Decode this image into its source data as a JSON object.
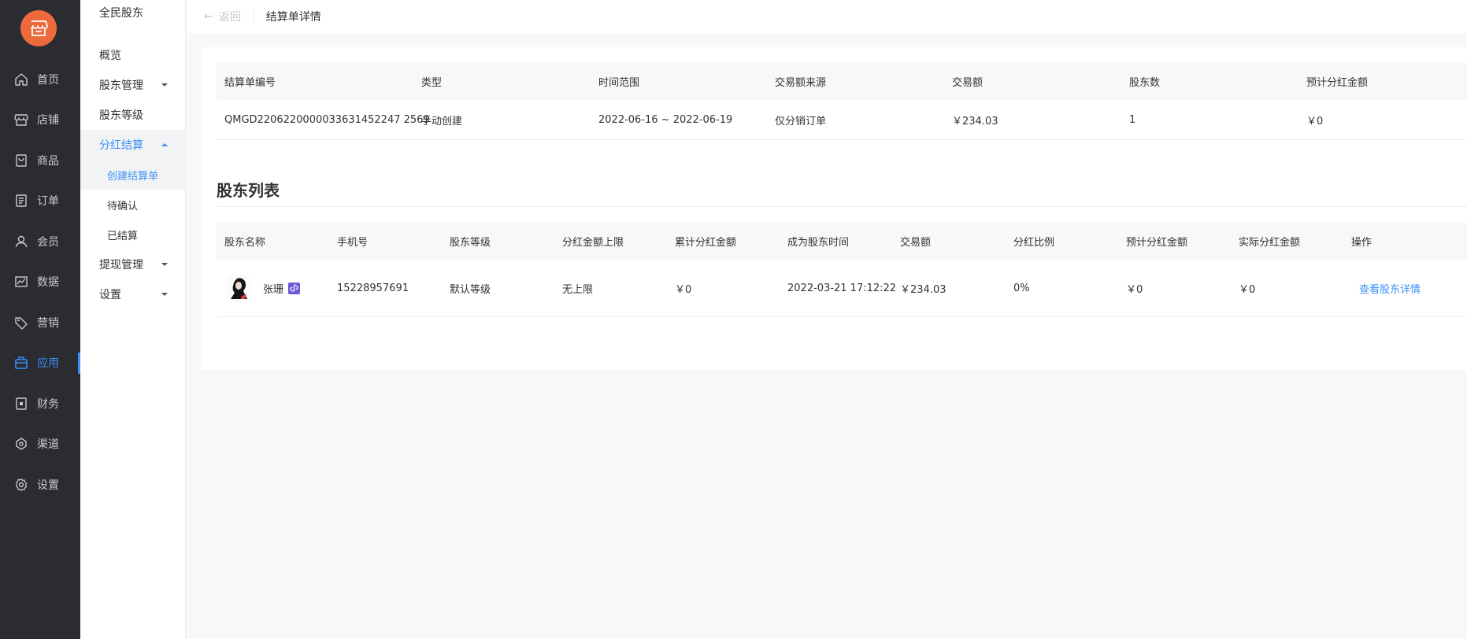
{
  "nav1": {
    "items": [
      {
        "label": "首页",
        "icon": "home-icon"
      },
      {
        "label": "店铺",
        "icon": "store-icon"
      },
      {
        "label": "商品",
        "icon": "goods-icon"
      },
      {
        "label": "订单",
        "icon": "order-icon"
      },
      {
        "label": "会员",
        "icon": "member-icon"
      },
      {
        "label": "数据",
        "icon": "chart-icon"
      },
      {
        "label": "营销",
        "icon": "tag-icon"
      },
      {
        "label": "应用",
        "icon": "apps-icon"
      },
      {
        "label": "财务",
        "icon": "finance-icon"
      },
      {
        "label": "渠道",
        "icon": "channel-icon"
      },
      {
        "label": "设置",
        "icon": "gear-icon"
      }
    ],
    "active_index": 7,
    "accent": "#3b8ff7",
    "logo_color": "#ee6a3c"
  },
  "nav2": {
    "title": "全民股东",
    "overview": "概览",
    "shareholder_mgmt": "股东管理",
    "shareholder_level": "股东等级",
    "dividend": "分红结算",
    "sub_create": "创建结算单",
    "sub_pending": "待确认",
    "sub_settled": "已结算",
    "withdraw": "提现管理",
    "settings": "设置"
  },
  "header": {
    "back": "返回",
    "title": "结算单详情"
  },
  "summary": {
    "headers": [
      "结算单编号",
      "类型",
      "时间范围",
      "交易额来源",
      "交易额",
      "股东数",
      "预计分红金额"
    ],
    "row": [
      "QMGD2206220000033631452247 2569",
      "手动创建",
      "2022-06-16 ~ 2022-06-19",
      "仅分销订单",
      "￥234.03",
      "1",
      "￥0"
    ]
  },
  "list": {
    "title": "股东列表",
    "headers": [
      "股东名称",
      "手机号",
      "股东等级",
      "分红金额上限",
      "累计分红金额",
      "成为股东时间",
      "交易额",
      "分红比例",
      "预计分红金额",
      "实际分红金额",
      "操作"
    ],
    "rows": [
      {
        "name": "张珊",
        "phone": "15228957691",
        "level": "默认等级",
        "cap": "无上限",
        "cumulative": "￥0",
        "joined": "2022-03-21 17:12:22",
        "amount": "￥234.03",
        "ratio": "0%",
        "estimated": "￥0",
        "actual": "￥0",
        "action": "查看股东详情"
      }
    ]
  }
}
